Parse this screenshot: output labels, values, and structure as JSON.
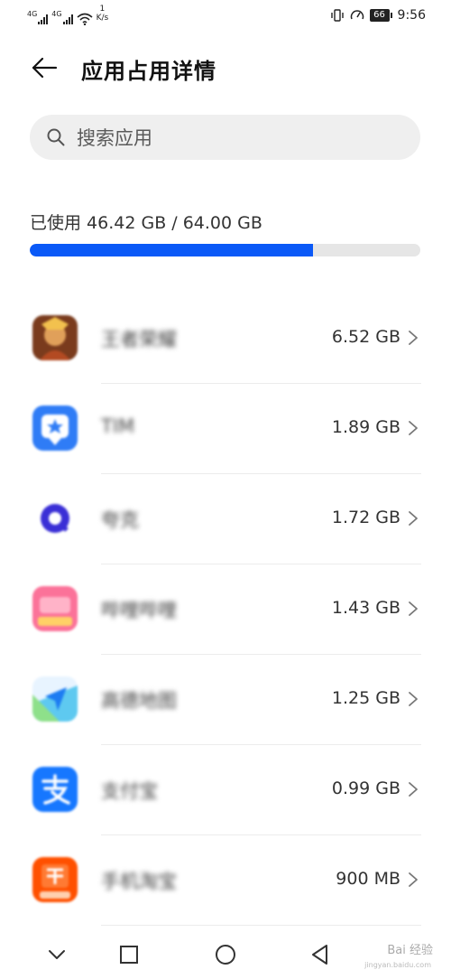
{
  "status_bar": {
    "signal1_gen": "4G",
    "signal2_gen": "4G",
    "net_speed_value": "1",
    "net_speed_unit": "K/s",
    "battery": "66",
    "time": "9:56"
  },
  "header": {
    "title": "应用占用详情",
    "back_icon": "arrow-left-icon"
  },
  "search": {
    "placeholder": "搜索应用",
    "value": ""
  },
  "storage": {
    "label": "已使用 46.42 GB / 64.00 GB",
    "used_fraction": 0.725,
    "bar_color": "#0a59f7"
  },
  "apps": [
    {
      "name": "王者荣耀",
      "size": "6.52 GB",
      "icon": "game-icon"
    },
    {
      "name": "TIM",
      "size": "1.89 GB",
      "icon": "tim-icon"
    },
    {
      "name": "夸克",
      "size": "1.72 GB",
      "icon": "quark-icon"
    },
    {
      "name": "哔哩哔哩",
      "size": "1.43 GB",
      "icon": "bilibili-icon"
    },
    {
      "name": "高德地图",
      "size": "1.25 GB",
      "icon": "amap-icon"
    },
    {
      "name": "支付宝",
      "size": "0.99 GB",
      "icon": "alipay-icon"
    },
    {
      "name": "手机淘宝",
      "size": "900 MB",
      "icon": "taobao-icon"
    }
  ],
  "nav": {
    "icons": [
      "chevron-down-icon",
      "recents-square-icon",
      "home-circle-icon",
      "back-triangle-icon"
    ]
  },
  "watermark": {
    "brand": "Bai 经验",
    "domain": "jingyan.baidu.com"
  }
}
